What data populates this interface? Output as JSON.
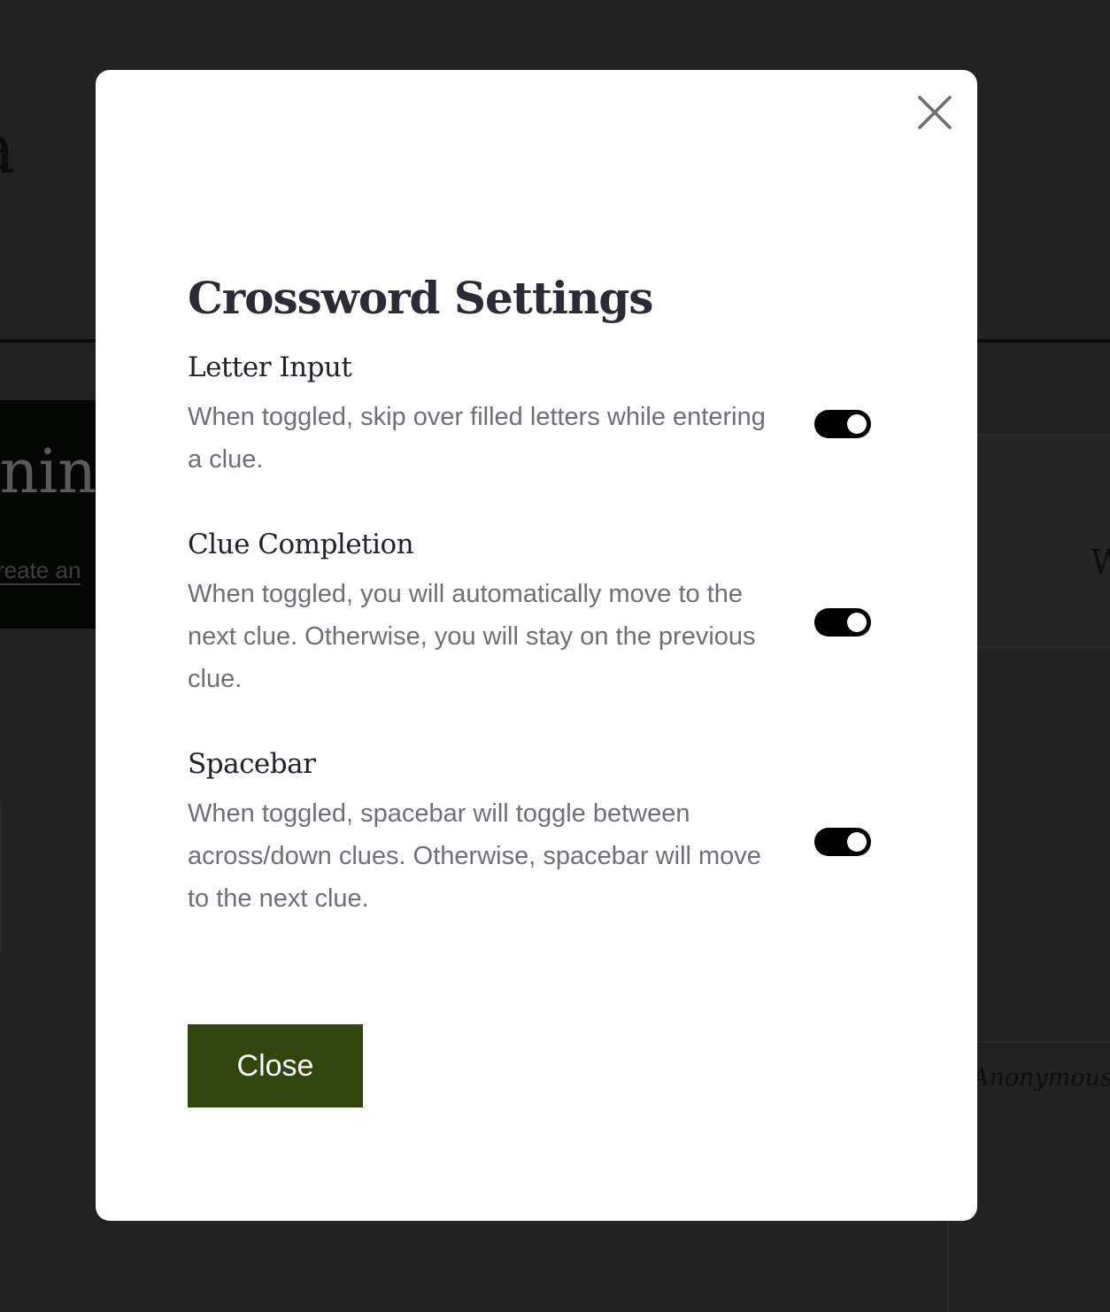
{
  "background": {
    "hero_title": "inin",
    "hero_link": "reate an",
    "left_fragment": "a",
    "right_fragment": "W",
    "author_fragment": "Anonymous c"
  },
  "modal": {
    "title": "Crossword Settings",
    "settings": [
      {
        "label": "Letter Input",
        "description": "When toggled, skip over filled letters while entering a clue.",
        "enabled": true
      },
      {
        "label": "Clue Completion",
        "description": "When toggled, you will automatically move to the next clue. Otherwise, you will stay on the previous clue.",
        "enabled": true
      },
      {
        "label": "Spacebar",
        "description": "When toggled, spacebar will toggle between across/down clues. Otherwise, spacebar will move to the next clue.",
        "enabled": true
      }
    ],
    "close_label": "Close",
    "close_icon": "close-icon"
  },
  "colors": {
    "overlay": "#222222",
    "modal_bg": "#ffffff",
    "title": "#2b2b35",
    "description": "#6d7077",
    "toggle_on": "#000000",
    "button_bg": "#33460d",
    "button_text": "#ffffff"
  }
}
